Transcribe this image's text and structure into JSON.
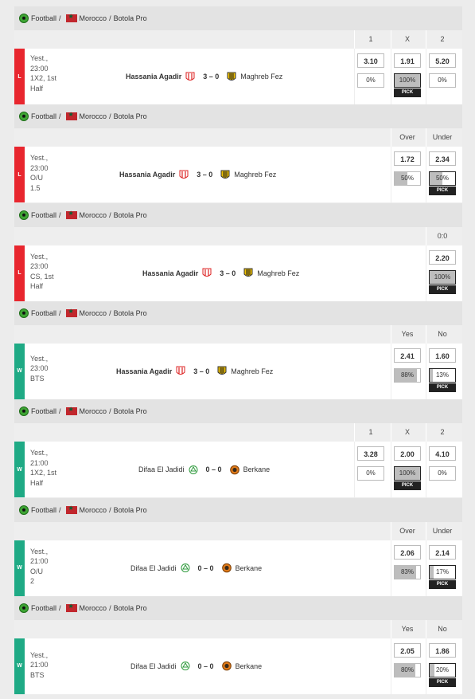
{
  "breadcrumb": {
    "sport": "Football",
    "country": "Morocco",
    "league": "Botola Pro",
    "sep": "/"
  },
  "pick_label": "PICK",
  "colors": {
    "lose": "#e8262e",
    "win": "#1faa85",
    "pick": "#222222"
  },
  "blocks": [
    {
      "result": "L",
      "info": [
        "Yest.,",
        "23:00",
        "1X2, 1st",
        "Half"
      ],
      "home": "Hassania Agadir",
      "away": "Maghreb Fez",
      "score": "3 – 0",
      "outcomes": [
        {
          "label": "1",
          "odd": "3.10",
          "pct": "0%",
          "pick": false
        },
        {
          "label": "X",
          "odd": "1.91",
          "pct": "100%",
          "pick": true
        },
        {
          "label": "2",
          "odd": "5.20",
          "pct": "0%",
          "pick": false
        }
      ]
    },
    {
      "result": "L",
      "info": [
        "Yest.,",
        "23:00",
        "O/U",
        "1.5"
      ],
      "home": "Hassania Agadir",
      "away": "Maghreb Fez",
      "score": "3 – 0",
      "outcomes": [
        {
          "label": "Over",
          "odd": "1.72",
          "pct": "50%",
          "pick": false
        },
        {
          "label": "Under",
          "odd": "2.34",
          "pct": "50%",
          "pick": true
        }
      ]
    },
    {
      "result": "L",
      "info": [
        "Yest.,",
        "23:00",
        "CS, 1st",
        "Half"
      ],
      "home": "Hassania Agadir",
      "away": "Maghreb Fez",
      "score": "3 – 0",
      "outcomes": [
        {
          "label": "0:0",
          "odd": "2.20",
          "pct": "100%",
          "pick": true
        }
      ]
    },
    {
      "result": "W",
      "info": [
        "Yest.,",
        "23:00",
        "BTS"
      ],
      "home": "Hassania Agadir",
      "away": "Maghreb Fez",
      "score": "3 – 0",
      "outcomes": [
        {
          "label": "Yes",
          "odd": "2.41",
          "pct": "88%",
          "pick": false
        },
        {
          "label": "No",
          "odd": "1.60",
          "pct": "13%",
          "pick": true
        }
      ]
    },
    {
      "result": "W",
      "info": [
        "Yest.,",
        "21:00",
        "1X2, 1st",
        "Half"
      ],
      "home": "Difaa El Jadidi",
      "away": "Berkane",
      "score": "0 – 0",
      "outcomes": [
        {
          "label": "1",
          "odd": "3.28",
          "pct": "0%",
          "pick": false
        },
        {
          "label": "X",
          "odd": "2.00",
          "pct": "100%",
          "pick": true
        },
        {
          "label": "2",
          "odd": "4.10",
          "pct": "0%",
          "pick": false
        }
      ]
    },
    {
      "result": "W",
      "info": [
        "Yest.,",
        "21:00",
        "O/U",
        "2"
      ],
      "home": "Difaa El Jadidi",
      "away": "Berkane",
      "score": "0 – 0",
      "outcomes": [
        {
          "label": "Over",
          "odd": "2.06",
          "pct": "83%",
          "pick": false
        },
        {
          "label": "Under",
          "odd": "2.14",
          "pct": "17%",
          "pick": true
        }
      ]
    },
    {
      "result": "W",
      "info": [
        "Yest.,",
        "21:00",
        "BTS"
      ],
      "home": "Difaa El Jadidi",
      "away": "Berkane",
      "score": "0 – 0",
      "outcomes": [
        {
          "label": "Yes",
          "odd": "2.05",
          "pct": "80%",
          "pick": false
        },
        {
          "label": "No",
          "odd": "1.86",
          "pct": "20%",
          "pick": true
        }
      ]
    }
  ]
}
